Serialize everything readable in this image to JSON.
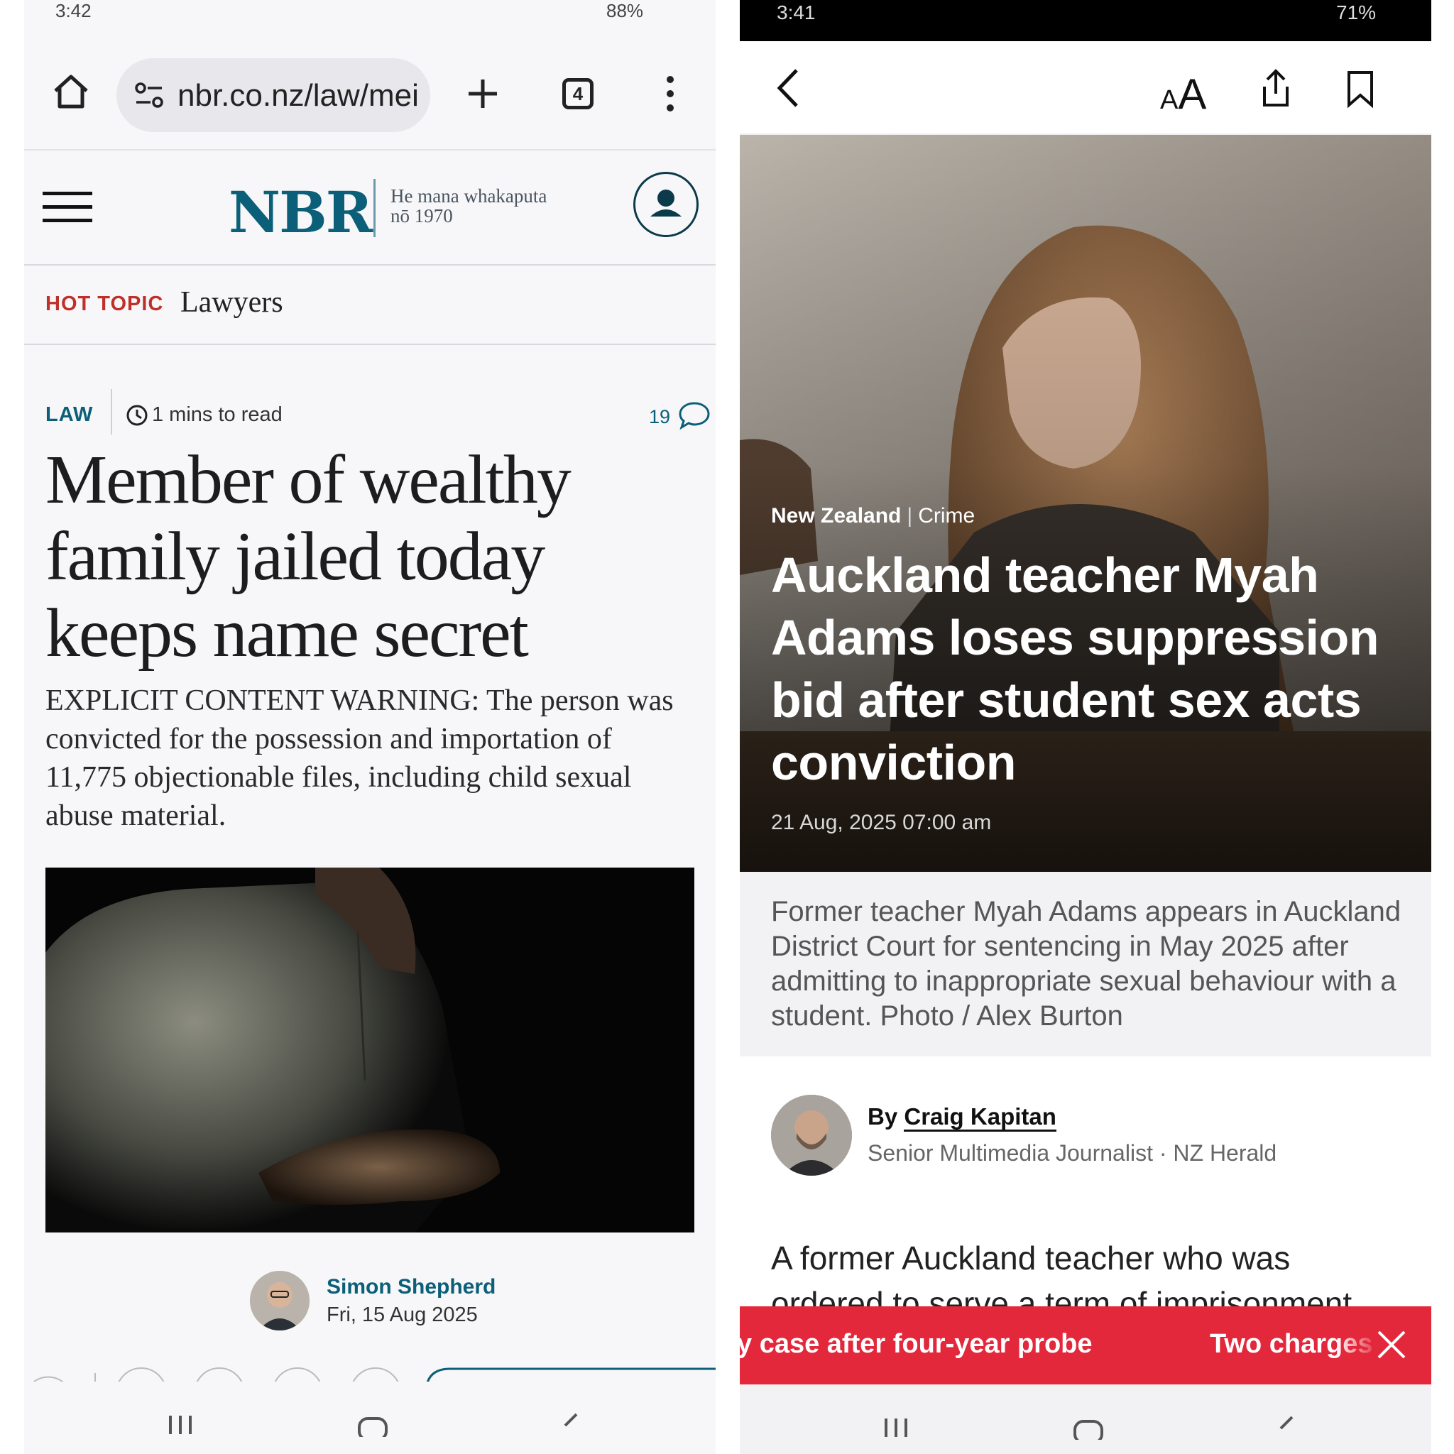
{
  "left": {
    "status_bar": {
      "time": "3:42",
      "battery": "88%"
    },
    "browser": {
      "url": "nbr.co.nz/law/mei",
      "tab_count": "4"
    },
    "site": {
      "logo": "NBR",
      "tagline_line1": "He mana whakaputa",
      "tagline_line2": "nō 1970",
      "brand_color": "#0b5f78"
    },
    "hot_topic": {
      "label": "HOT TOPIC",
      "topic": "Lawyers"
    },
    "article": {
      "section": "LAW",
      "read_time": "1 mins to read",
      "comment_count": "19",
      "headline": "Member of wealthy family jailed today keeps name secret",
      "standfirst": "EXPLICIT CONTENT WARNING: The person was convicted for the possession and importation of 11,775 objectionable files, including child sexual abuse material.",
      "author": "Simon Shepherd",
      "date": "Fri, 15 Aug 2025"
    }
  },
  "right": {
    "status_bar": {
      "time": "3:41",
      "battery": "71%"
    },
    "toolbar": {
      "text_size_small": "A",
      "text_size_large": "A"
    },
    "article": {
      "category_primary": "New Zealand",
      "category_secondary": "Crime",
      "headline": "Auckland teacher Myah Adams loses suppression bid after student sex acts conviction",
      "date": "21 Aug, 2025 07:00 am",
      "caption": "Former teacher Myah Adams appears in Auckland District Court for sentencing in May 2025 after admitting to inappropriate sexual behaviour with a student. Photo / Alex Burton",
      "by_prefix": "By",
      "author": "Craig Kapitan",
      "author_role": "Senior Multimedia Journalist",
      "publication": "NZ Herald",
      "body_start": "A former Auckland teacher who was ordered to serve a term of imprisonment"
    },
    "breaking_banner": {
      "item1": "y case after four-year probe",
      "item2": "Two charges",
      "accent_color": "#e4283c"
    }
  }
}
